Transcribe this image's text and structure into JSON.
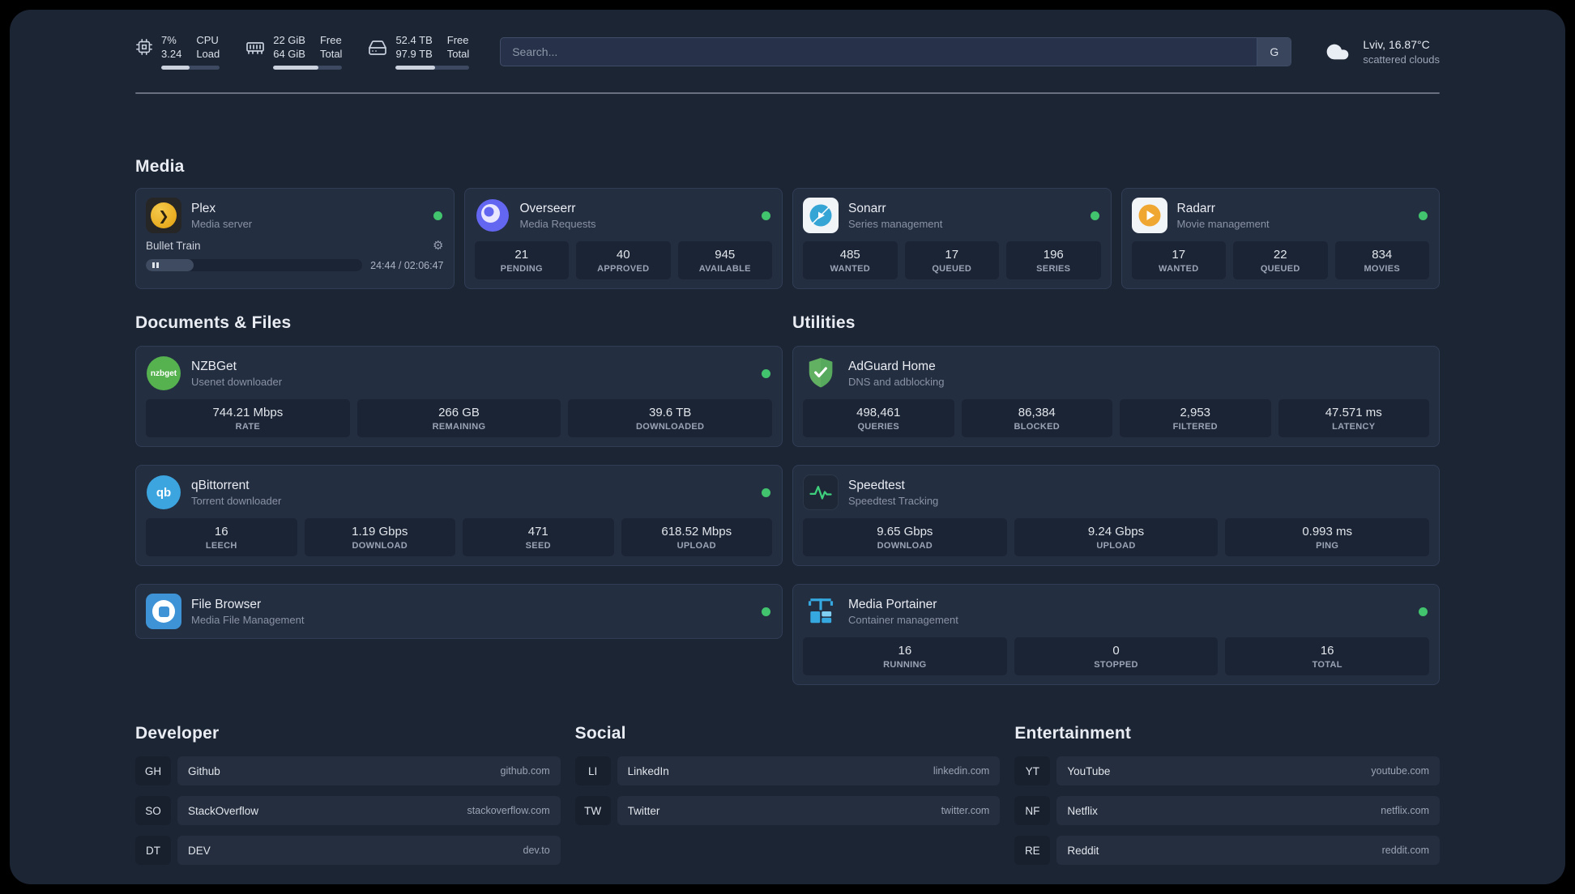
{
  "topbar": {
    "cpu": {
      "usage": "7%",
      "load": "3.24",
      "label_top": "CPU",
      "label_bottom": "Load",
      "bar_percent": 48
    },
    "memory": {
      "free": "22 GiB",
      "total": "64 GiB",
      "label_top": "Free",
      "label_bottom": "Total",
      "bar_percent": 66
    },
    "disk": {
      "free": "52.4 TB",
      "total": "97.9 TB",
      "label_top": "Free",
      "label_bottom": "Total",
      "bar_percent": 54
    },
    "search": {
      "placeholder": "Search...",
      "provider_label": "G"
    },
    "weather": {
      "location": "Lviv, 16.87°C",
      "condition": "scattered clouds"
    }
  },
  "sections": {
    "media": "Media",
    "documents": "Documents & Files",
    "utilities": "Utilities",
    "developer": "Developer",
    "social": "Social",
    "entertainment": "Entertainment"
  },
  "services": {
    "plex": {
      "name": "Plex",
      "desc": "Media server",
      "icon_glyph": "❯",
      "now_playing": {
        "title": "Bullet Train",
        "time": "24:44 / 02:06:47",
        "progress_percent": 22
      }
    },
    "overseerr": {
      "name": "Overseerr",
      "desc": "Media Requests",
      "stats": [
        {
          "value": "21",
          "label": "PENDING"
        },
        {
          "value": "40",
          "label": "APPROVED"
        },
        {
          "value": "945",
          "label": "AVAILABLE"
        }
      ]
    },
    "sonarr": {
      "name": "Sonarr",
      "desc": "Series management",
      "stats": [
        {
          "value": "485",
          "label": "WANTED"
        },
        {
          "value": "17",
          "label": "QUEUED"
        },
        {
          "value": "196",
          "label": "SERIES"
        }
      ]
    },
    "radarr": {
      "name": "Radarr",
      "desc": "Movie management",
      "stats": [
        {
          "value": "17",
          "label": "WANTED"
        },
        {
          "value": "22",
          "label": "QUEUED"
        },
        {
          "value": "834",
          "label": "MOVIES"
        }
      ]
    },
    "nzbget": {
      "name": "NZBGet",
      "desc": "Usenet downloader",
      "icon_label": "nzbget",
      "stats": [
        {
          "value": "744.21 Mbps",
          "label": "RATE"
        },
        {
          "value": "266 GB",
          "label": "REMAINING"
        },
        {
          "value": "39.6 TB",
          "label": "DOWNLOADED"
        }
      ]
    },
    "qbittorrent": {
      "name": "qBittorrent",
      "desc": "Torrent downloader",
      "icon_label": "qb",
      "stats": [
        {
          "value": "16",
          "label": "LEECH"
        },
        {
          "value": "1.19 Gbps",
          "label": "DOWNLOAD"
        },
        {
          "value": "471",
          "label": "SEED"
        },
        {
          "value": "618.52 Mbps",
          "label": "UPLOAD"
        }
      ]
    },
    "filebrowser": {
      "name": "File Browser",
      "desc": "Media File Management"
    },
    "adguard": {
      "name": "AdGuard Home",
      "desc": "DNS and adblocking",
      "stats": [
        {
          "value": "498,461",
          "label": "QUERIES"
        },
        {
          "value": "86,384",
          "label": "BLOCKED"
        },
        {
          "value": "2,953",
          "label": "FILTERED"
        },
        {
          "value": "47.571 ms",
          "label": "LATENCY"
        }
      ]
    },
    "speedtest": {
      "name": "Speedtest",
      "desc": "Speedtest Tracking",
      "stats": [
        {
          "value": "9.65 Gbps",
          "label": "DOWNLOAD"
        },
        {
          "value": "9.24 Gbps",
          "label": "UPLOAD"
        },
        {
          "value": "0.993 ms",
          "label": "PING"
        }
      ]
    },
    "portainer": {
      "name": "Media Portainer",
      "desc": "Container management",
      "stats": [
        {
          "value": "16",
          "label": "RUNNING"
        },
        {
          "value": "0",
          "label": "STOPPED"
        },
        {
          "value": "16",
          "label": "TOTAL"
        }
      ]
    }
  },
  "bookmarks": {
    "developer": {
      "items": [
        {
          "abbr": "GH",
          "name": "Github",
          "domain": "github.com"
        },
        {
          "abbr": "SO",
          "name": "StackOverflow",
          "domain": "stackoverflow.com"
        },
        {
          "abbr": "DT",
          "name": "DEV",
          "domain": "dev.to"
        }
      ]
    },
    "social": {
      "items": [
        {
          "abbr": "LI",
          "name": "LinkedIn",
          "domain": "linkedin.com"
        },
        {
          "abbr": "TW",
          "name": "Twitter",
          "domain": "twitter.com"
        }
      ]
    },
    "entertainment": {
      "items": [
        {
          "abbr": "YT",
          "name": "YouTube",
          "domain": "youtube.com"
        },
        {
          "abbr": "NF",
          "name": "Netflix",
          "domain": "netflix.com"
        },
        {
          "abbr": "RE",
          "name": "Reddit",
          "domain": "reddit.com"
        }
      ]
    }
  },
  "colors": {
    "status_online": "#41c46d"
  }
}
